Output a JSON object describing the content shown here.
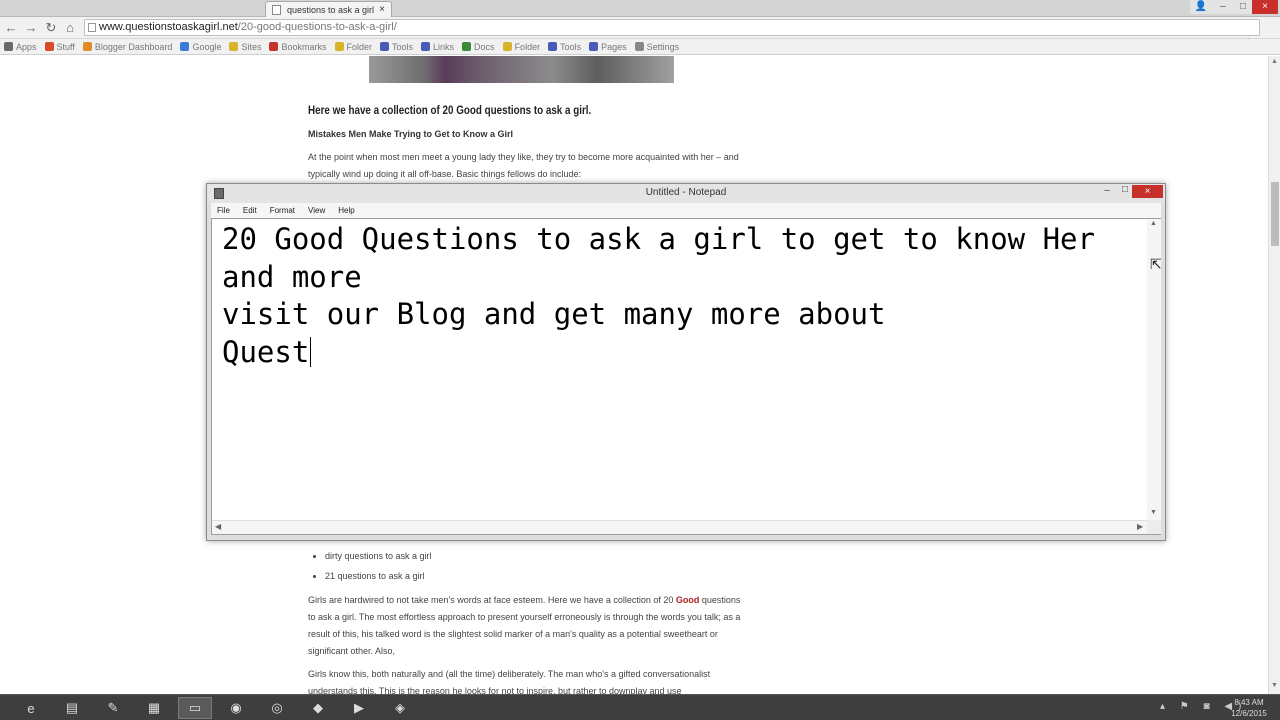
{
  "browser": {
    "tab_title": "questions to ask a girl",
    "tab_close": "×",
    "url_domain": "www.questionstoaskagirl.net",
    "url_path": "/20-good-questions-to-ask-a-girl/",
    "window_controls": {
      "user": "👤",
      "minimize": "–",
      "maximize": "□",
      "close": "×"
    }
  },
  "bookmarks": [
    {
      "label": "Apps",
      "color": "#6a6a6a"
    },
    {
      "label": "Stuff",
      "color": "#d84a2a"
    },
    {
      "label": "Blogger Dashboard",
      "color": "#e08a2a"
    },
    {
      "label": "Google",
      "color": "#3a7ad8"
    },
    {
      "label": "Sites",
      "color": "#d8b42a"
    },
    {
      "label": "Bookmarks",
      "color": "#c7312c"
    },
    {
      "label": "Folder",
      "color": "#d8b42a"
    },
    {
      "label": "Tools",
      "color": "#4a5ab8"
    },
    {
      "label": "Links",
      "color": "#4a5ab8"
    },
    {
      "label": "Docs",
      "color": "#3a8a3a"
    },
    {
      "label": "Folder",
      "color": "#d8b42a"
    },
    {
      "label": "Tools",
      "color": "#4a5ab8"
    },
    {
      "label": "Pages",
      "color": "#4a5ab8"
    },
    {
      "label": "Settings",
      "color": "#888888"
    }
  ],
  "article": {
    "heading": "Here we have a collection of 20 Good questions to ask a girl.",
    "subheading": "Mistakes Men Make Trying to Get to Know a Girl",
    "para1": "At the point when most men meet a young lady they like, they try to become more acquainted with her – and typically wind up doing it all off-base. Basic things fellows do include:",
    "bullets": [
      "dirty questions to ask a girl",
      "21 questions to ask a girl"
    ],
    "para2_before": "Girls are hardwired to not take men's words at face esteem. Here we have a collection of 20 ",
    "para2_good": "Good",
    "para2_after": " questions to ask a girl. The most effortless approach to present yourself erroneously is through the words you talk; as a result of this, his talked word is the slightest solid marker of a man's quality as a potential sweetheart or significant other. Also,",
    "para3": "Girls know this, both naturally and (all the time) deliberately. The man who's a gifted conversationalist understands this. This is the reason he looks for not to inspire, but rather to downplay and use"
  },
  "notepad": {
    "title": "Untitled - Notepad",
    "menu": [
      "File",
      "Edit",
      "Format",
      "View",
      "Help"
    ],
    "lines": [
      "20 Good Questions to ask a girl to get to know Her",
      "and more",
      "visit our Blog and get many more about",
      "Quest"
    ],
    "close_glyph": "×",
    "min_glyph": "–",
    "max_glyph": "□"
  },
  "taskbar": {
    "items": [
      {
        "icon": "internet-explorer-icon",
        "glyph": "e"
      },
      {
        "icon": "file-explorer-icon",
        "glyph": "▤"
      },
      {
        "icon": "paint-icon",
        "glyph": "✎"
      },
      {
        "icon": "control-panel-icon",
        "glyph": "▦"
      },
      {
        "icon": "notepad-icon",
        "glyph": "▭"
      },
      {
        "icon": "firefox-icon",
        "glyph": "◉"
      },
      {
        "icon": "chrome-icon",
        "glyph": "◎"
      },
      {
        "icon": "app-icon",
        "glyph": "◆"
      },
      {
        "icon": "media-player-icon",
        "glyph": "▶"
      },
      {
        "icon": "tool-icon",
        "glyph": "◈"
      }
    ],
    "tray": "▴ ⚑ ◙ ◀)",
    "time": "8:43 AM",
    "date": "12/6/2015"
  }
}
